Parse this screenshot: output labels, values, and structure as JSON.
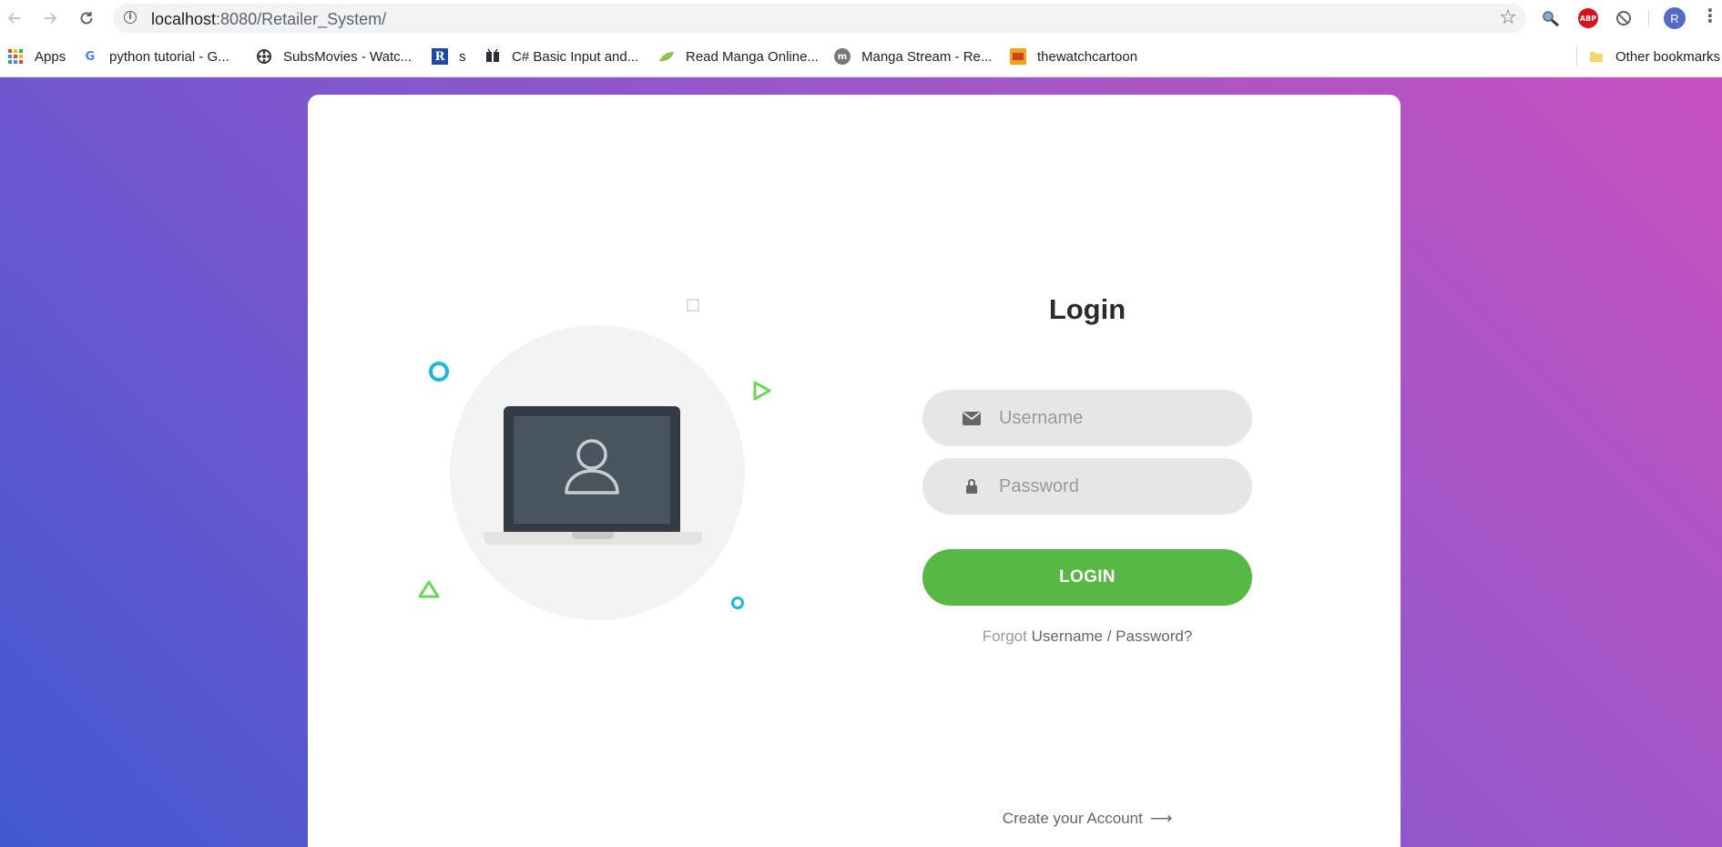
{
  "browser": {
    "url_host": "localhost",
    "url_rest": ":8080/Retailer_System/",
    "profile_initial": "R",
    "abp_label": "ABP",
    "icons": {
      "back": "arrow-left-icon",
      "forward": "arrow-right-icon",
      "reload": "reload-icon",
      "info": "info-icon",
      "star": "star-icon",
      "menu": "kebab-menu-icon"
    }
  },
  "bookmarks": {
    "apps_label": "Apps",
    "items": [
      {
        "label": "python tutorial - G...",
        "icon": "google-g-icon"
      },
      {
        "label": "SubsMovies - Watc...",
        "icon": "film-reel-icon"
      },
      {
        "label": "s",
        "icon": "r-logo-icon"
      },
      {
        "label": "C# Basic Input and...",
        "icon": "book-icon"
      },
      {
        "label": "Read Manga Online...",
        "icon": "leaf-icon"
      },
      {
        "label": "Manga Stream - Re...",
        "icon": "m-badge-icon"
      },
      {
        "label": "thewatchcartoon",
        "icon": "tv-icon"
      }
    ],
    "other_label": "Other bookmarks"
  },
  "theme": {
    "accent_green": "#57b846",
    "gradient_start": "#4158d0",
    "gradient_end": "#c850c0",
    "deco_blue": "#1cb7e0",
    "deco_green": "#6bd65a"
  },
  "login": {
    "title": "Login",
    "username_placeholder": "Username",
    "password_placeholder": "Password",
    "button_label": "LOGIN",
    "forgot_prefix": "Forgot",
    "forgot_link": "Username / Password?",
    "create_account": "Create your Account",
    "create_arrow": "⟶"
  }
}
